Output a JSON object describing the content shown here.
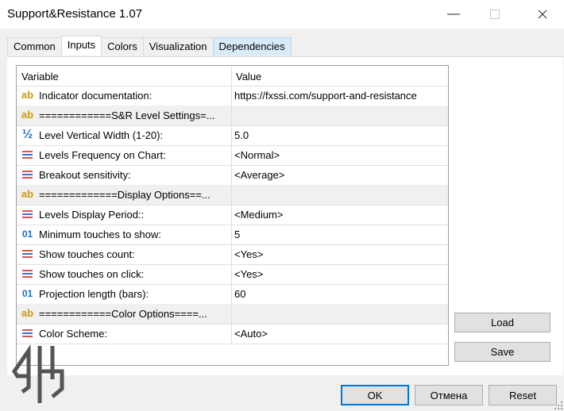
{
  "window": {
    "title": "Support&Resistance 1.07"
  },
  "tabs": [
    {
      "label": "Common",
      "active": false
    },
    {
      "label": "Inputs",
      "active": true
    },
    {
      "label": "Colors",
      "active": false
    },
    {
      "label": "Visualization",
      "active": false
    },
    {
      "label": "Dependencies",
      "active": false,
      "highlight": true
    }
  ],
  "grid": {
    "headers": {
      "variable": "Variable",
      "value": "Value"
    },
    "rows": [
      {
        "icon": "ab-icon",
        "variable": "Indicator documentation:",
        "value": "https://fxssi.com/support-and-resistance",
        "section": false
      },
      {
        "icon": "ab-icon",
        "variable": "============S&R Level Settings=...",
        "value": "",
        "section": true
      },
      {
        "icon": "fraction-icon",
        "variable": "Level Vertical Width (1-20):",
        "value": "5.0",
        "section": false
      },
      {
        "icon": "list-icon",
        "variable": "Levels Frequency on Chart:",
        "value": "<Normal>",
        "section": false
      },
      {
        "icon": "list-icon",
        "variable": "Breakout sensitivity:",
        "value": "<Average>",
        "section": false
      },
      {
        "icon": "ab-icon",
        "variable": "=============Display Options==...",
        "value": "",
        "section": true
      },
      {
        "icon": "list-icon",
        "variable": "Levels Display Period::",
        "value": "<Medium>",
        "section": false
      },
      {
        "icon": "integer-icon",
        "variable": "Minimum touches to show:",
        "value": "5",
        "section": false
      },
      {
        "icon": "list-icon",
        "variable": "Show touches count:",
        "value": "<Yes>",
        "section": false
      },
      {
        "icon": "list-icon",
        "variable": "Show touches on click:",
        "value": "<Yes>",
        "section": false
      },
      {
        "icon": "integer-icon",
        "variable": "Projection length (bars):",
        "value": "60",
        "section": false
      },
      {
        "icon": "ab-icon",
        "variable": "============Color Options====...",
        "value": "",
        "section": true
      },
      {
        "icon": "list-icon",
        "variable": "Color Scheme:",
        "value": "<Auto>",
        "section": false
      }
    ]
  },
  "side_buttons": {
    "load": "Load",
    "save": "Save"
  },
  "footer_buttons": {
    "ok": "OK",
    "cancel": "Отмена",
    "reset": "Reset"
  },
  "icon_glyphs": {
    "ab": "ab",
    "fraction": "½",
    "integer": "01"
  },
  "colors": {
    "accent": "#0078d7",
    "ab_icon": "#c99a19",
    "numeric_icon": "#1e6ec8",
    "list_icon_red": "#d9534f",
    "list_icon_blue": "#3a6fd8"
  }
}
